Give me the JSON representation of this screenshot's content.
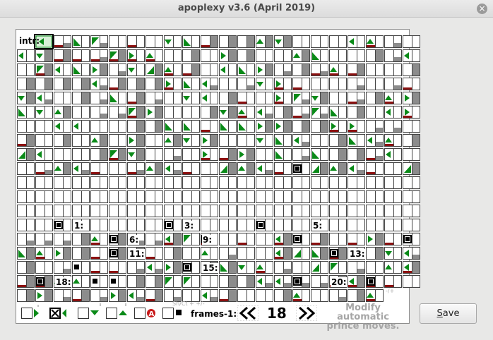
{
  "window": {
    "title": "apoplexy v3.6 (April 2019)",
    "close_icon": "×"
  },
  "grid": {
    "intr_label": "intr:",
    "room_labels": [
      {
        "text": "1:",
        "row": 13,
        "col": 3
      },
      {
        "text": "3:",
        "row": 13,
        "col": 9
      },
      {
        "text": "5:",
        "row": 13,
        "col": 16
      },
      {
        "text": "6:",
        "row": 14,
        "col": 6
      },
      {
        "text": "9:",
        "row": 14,
        "col": 10
      },
      {
        "text": "11:",
        "row": 15,
        "col": 6
      },
      {
        "text": "13:",
        "row": 15,
        "col": 18
      },
      {
        "text": "15:",
        "row": 16,
        "col": 10
      },
      {
        "text": "18:",
        "row": 17,
        "col": 2
      },
      {
        "text": "20:",
        "row": 17,
        "col": 17
      }
    ]
  },
  "toolbar": {
    "shift_hint": "Sh/Ct + +/-",
    "minus_plus_hint": "-/+",
    "frames_label": "frames-1:",
    "frames_value": "18",
    "hint_line1": "Modify automatic",
    "hint_line2": "prince moves."
  },
  "save_button": {
    "label": "Save"
  },
  "colors": {
    "green": "#0a8a18",
    "dark_red": "#8b1010",
    "gray": "#8c8c8c",
    "black": "#000000",
    "red_circle": "#c81818"
  }
}
